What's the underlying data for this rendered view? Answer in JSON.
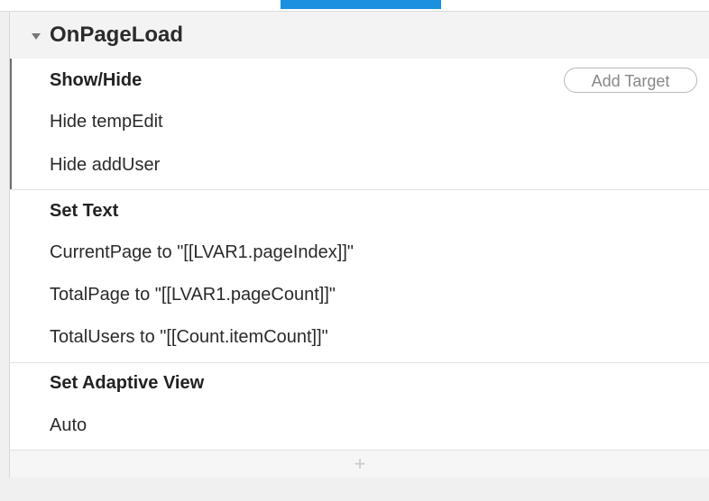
{
  "event": {
    "title": "OnPageLoad"
  },
  "add_target_label": "Add Target",
  "actions": [
    {
      "title": "Show/Hide",
      "items": [
        "Hide tempEdit",
        "Hide addUser"
      ]
    },
    {
      "title": "Set Text",
      "items": [
        "CurrentPage to \"[[LVAR1.pageIndex]]\"",
        "TotalPage to \"[[LVAR1.pageCount]]\"",
        "TotalUsers to \"[[Count.itemCount]]\""
      ]
    },
    {
      "title": "Set Adaptive View",
      "items": [
        "Auto"
      ]
    }
  ],
  "footer": {
    "add_symbol": "+"
  },
  "colors": {
    "tab_indicator": "#1b8fe0",
    "header_bg": "#f3f3f3"
  }
}
